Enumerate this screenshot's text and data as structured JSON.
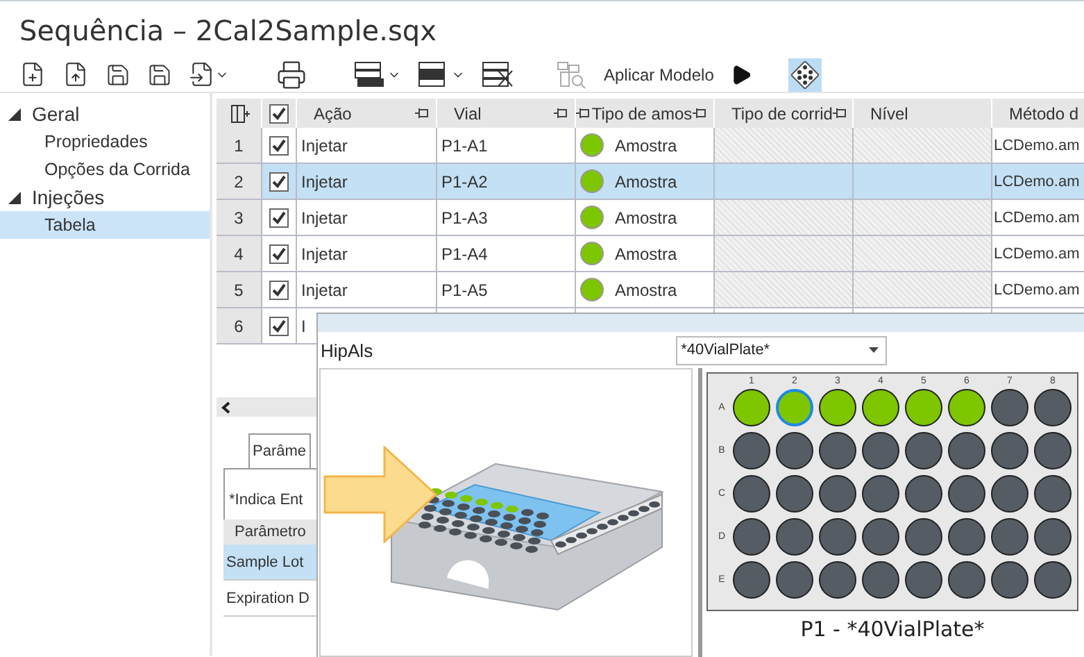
{
  "window": {
    "title": "Sequência – 2Cal2Sample.sqx"
  },
  "toolbar": {
    "apply_template": "Aplicar Modelo",
    "plate_view_selected": true
  },
  "sidebar": {
    "items": [
      {
        "label": "Geral",
        "expanded": true,
        "children": [
          {
            "label": "Propriedades",
            "selected": false
          },
          {
            "label": "Opções da Corrida",
            "selected": false
          }
        ]
      },
      {
        "label": "Injeções",
        "expanded": true,
        "children": [
          {
            "label": "Tabela",
            "selected": true
          }
        ]
      }
    ]
  },
  "table": {
    "all_checked": true,
    "columns": [
      "Ação",
      "Vial",
      "Tipo de amos",
      "Tipo de corrid",
      "Nível",
      "Método d"
    ],
    "rows": [
      {
        "number": "1",
        "checked": true,
        "selected": false,
        "action": "Injetar",
        "vial": "P1-A1",
        "sample_type": "Amostra",
        "color": "#7ec600",
        "method": "LCDemo.am"
      },
      {
        "number": "2",
        "checked": true,
        "selected": true,
        "action": "Injetar",
        "vial": "P1-A2",
        "sample_type": "Amostra",
        "color": "#7ec600",
        "method": "LCDemo.am"
      },
      {
        "number": "3",
        "checked": true,
        "selected": false,
        "action": "Injetar",
        "vial": "P1-A3",
        "sample_type": "Amostra",
        "color": "#7ec600",
        "method": "LCDemo.am"
      },
      {
        "number": "4",
        "checked": true,
        "selected": false,
        "action": "Injetar",
        "vial": "P1-A4",
        "sample_type": "Amostra",
        "color": "#7ec600",
        "method": "LCDemo.am"
      },
      {
        "number": "5",
        "checked": true,
        "selected": false,
        "action": "Injetar",
        "vial": "P1-A5",
        "sample_type": "Amostra",
        "color": "#7ec600",
        "method": "LCDemo.am"
      },
      {
        "number": "6",
        "checked": true,
        "selected": false,
        "action": "I"
      }
    ]
  },
  "lower_panel": {
    "tab": "Parâme",
    "note": "*Indica Ent",
    "parameter_header": "Parâmetro",
    "parameters": [
      {
        "label": "Sample Lot",
        "selected": true
      },
      {
        "label": "Expiration D",
        "selected": false
      }
    ]
  },
  "plate_popup": {
    "title": "HipAls",
    "plate_select": "*40VialPlate*",
    "caption": "P1 - *40VialPlate*",
    "plate_columns": [
      "1",
      "2",
      "3",
      "4",
      "5",
      "6",
      "7",
      "8"
    ],
    "plate_rows": [
      {
        "label": "A",
        "wells": [
          {
            "filled": true,
            "selected": false
          },
          {
            "filled": true,
            "selected": true
          },
          {
            "filled": true,
            "selected": false
          },
          {
            "filled": true,
            "selected": false
          },
          {
            "filled": true,
            "selected": false
          },
          {
            "filled": true,
            "selected": false
          },
          {
            "filled": false,
            "selected": false
          },
          {
            "filled": false,
            "selected": false
          }
        ]
      },
      {
        "label": "B",
        "wells": [
          {
            "filled": false,
            "selected": false
          },
          {
            "filled": false,
            "selected": false
          },
          {
            "filled": false,
            "selected": false
          },
          {
            "filled": false,
            "selected": false
          },
          {
            "filled": false,
            "selected": false
          },
          {
            "filled": false,
            "selected": false
          },
          {
            "filled": false,
            "selected": false
          },
          {
            "filled": false,
            "selected": false
          }
        ]
      },
      {
        "label": "C",
        "wells": [
          {
            "filled": false,
            "selected": false
          },
          {
            "filled": false,
            "selected": false
          },
          {
            "filled": false,
            "selected": false
          },
          {
            "filled": false,
            "selected": false
          },
          {
            "filled": false,
            "selected": false
          },
          {
            "filled": false,
            "selected": false
          },
          {
            "filled": false,
            "selected": false
          },
          {
            "filled": false,
            "selected": false
          }
        ]
      },
      {
        "label": "D",
        "wells": [
          {
            "filled": false,
            "selected": false
          },
          {
            "filled": false,
            "selected": false
          },
          {
            "filled": false,
            "selected": false
          },
          {
            "filled": false,
            "selected": false
          },
          {
            "filled": false,
            "selected": false
          },
          {
            "filled": false,
            "selected": false
          },
          {
            "filled": false,
            "selected": false
          },
          {
            "filled": false,
            "selected": false
          }
        ]
      },
      {
        "label": "E",
        "wells": [
          {
            "filled": false,
            "selected": false
          },
          {
            "filled": false,
            "selected": false
          },
          {
            "filled": false,
            "selected": false
          },
          {
            "filled": false,
            "selected": false
          },
          {
            "filled": false,
            "selected": false
          },
          {
            "filled": false,
            "selected": false
          },
          {
            "filled": false,
            "selected": false
          },
          {
            "filled": false,
            "selected": false
          }
        ]
      }
    ]
  }
}
